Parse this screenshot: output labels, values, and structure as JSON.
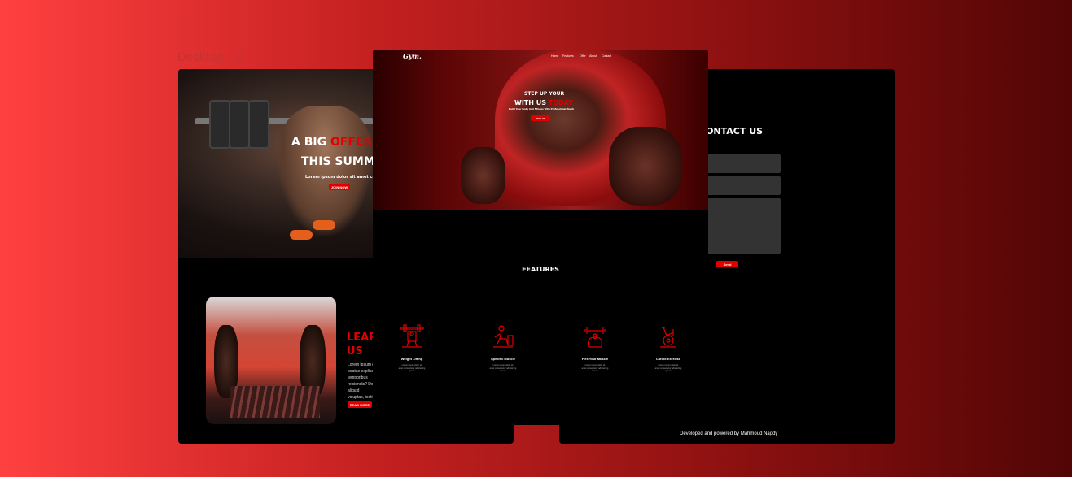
{
  "frame_label": "Desktop - 2",
  "left": {
    "hero_line1_white": "A BIG ",
    "hero_line1_red": "OFFER",
    "hero_line2": "THIS SUMM",
    "hero_sub": "Lorem ipsum dolor sit amet conse",
    "join_button": "JOIN NOW",
    "learn_title": "LEARI\nUS",
    "learn_text": "Lorem ipsum d\nbeatae explicab\ntemporibus\nreiciendis? Do\naliquid\nvoluptas, testi",
    "read_more": "READ MORE"
  },
  "middle": {
    "logo": "Gym.",
    "nav": [
      "Home",
      "Features",
      "Offer",
      "About",
      "Contact"
    ],
    "hero_line1": "STEP UP YOUR",
    "hero_line2_white": "WITH US ",
    "hero_line2_red": "TODAY",
    "hero_sub": "Build Your Body And Fitness With Professional Touch",
    "join_button": "JOIN US",
    "features_title": "FEATURES",
    "features": [
      {
        "icon": "weightlifting-icon",
        "name": "Weight Lifting",
        "desc": "Lorem ipsum dolor sit\namet consectetur adipisicing\nipsum"
      },
      {
        "icon": "stretching-icon",
        "name": "Specific Muscle",
        "desc": "Lorem ipsum dolor sit\namet consectetur adipisicing\nipsum"
      },
      {
        "icon": "dumbbell-muscle-icon",
        "name": "Flex Your Muscle",
        "desc": "Lorem ipsum dolor sit\namet consectetur adipisicing\nipsum"
      },
      {
        "icon": "exercise-bike-icon",
        "name": "Cardio Exercise",
        "desc": "Lorem ipsum dolor sit\namet consectetur adipisicing\nipsum"
      }
    ]
  },
  "right": {
    "contact_title": "CONTACT US",
    "send_button": "Send",
    "footer": "Developed and powered by Mahmoud Nagdy"
  },
  "colors": {
    "accent": "#e10000",
    "panel": "#000000"
  }
}
